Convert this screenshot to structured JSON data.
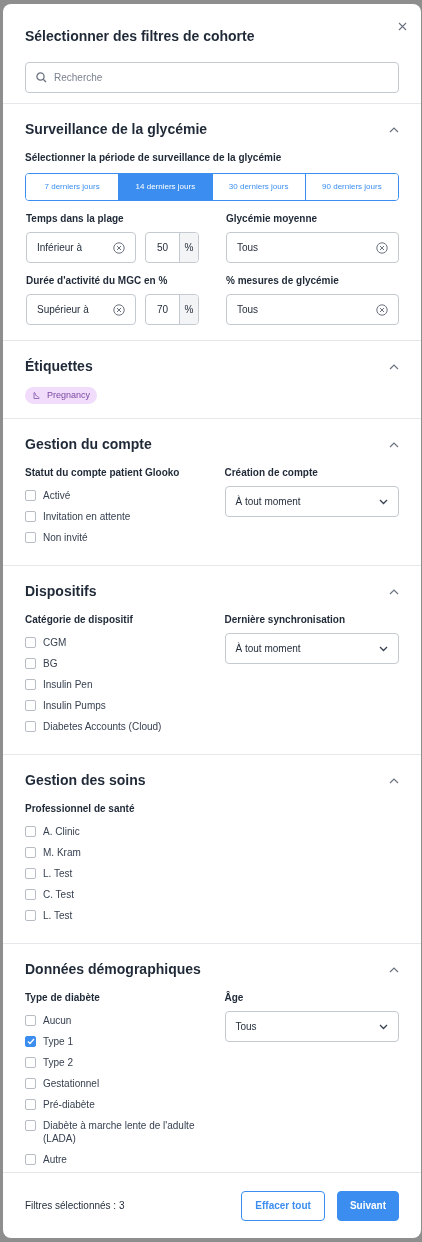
{
  "dialog": {
    "title": "Sélectionner des filtres de cohorte",
    "search": {
      "placeholder": "Recherche"
    }
  },
  "glucose": {
    "title": "Surveillance de la glycémie",
    "expanded": true,
    "period_label": "Sélectionner la période de surveillance de la glycémie",
    "periods": [
      {
        "label": "7 derniers jours",
        "selected": false
      },
      {
        "label": "14 derniers jours",
        "selected": true
      },
      {
        "label": "30 derniers jours",
        "selected": false
      },
      {
        "label": "90 derniers jours",
        "selected": false
      }
    ],
    "filters": [
      {
        "label": "Temps dans la plage",
        "kind": "range",
        "condition": "Inférieur à",
        "value": "50",
        "unit": "%"
      },
      {
        "label": "Glycémie moyenne",
        "kind": "select",
        "value": "Tous"
      },
      {
        "label": "Durée d'activité du MGC en %",
        "kind": "range",
        "condition": "Supérieur à",
        "value": "70",
        "unit": "%"
      },
      {
        "label": "% mesures de glycémie",
        "kind": "select",
        "value": "Tous"
      }
    ]
  },
  "tags": {
    "title": "Étiquettes",
    "expanded": true,
    "items": [
      {
        "label": "Pregnancy"
      }
    ]
  },
  "sections": [
    {
      "title": "Gestion du compte",
      "expanded": true,
      "group": {
        "label": "Statut du compte patient Glooko",
        "options": [
          {
            "label": "Activé",
            "checked": false
          },
          {
            "label": "Invitation en attente",
            "checked": false
          },
          {
            "label": "Non invité",
            "checked": false
          }
        ]
      },
      "dropdown": {
        "label": "Création de compte",
        "value": "À tout moment"
      }
    },
    {
      "title": "Dispositifs",
      "expanded": true,
      "group": {
        "label": "Catégorie de dispositif",
        "options": [
          {
            "label": "CGM",
            "checked": false
          },
          {
            "label": "BG",
            "checked": false
          },
          {
            "label": "Insulin Pen",
            "checked": false
          },
          {
            "label": "Insulin Pumps",
            "checked": false
          },
          {
            "label": "Diabetes Accounts (Cloud)",
            "checked": false
          }
        ]
      },
      "dropdown": {
        "label": "Dernière synchronisation",
        "value": "À tout moment"
      }
    },
    {
      "title": "Gestion des soins",
      "expanded": true,
      "group": {
        "label": "Professionnel de santé",
        "options": [
          {
            "label": "A. Clinic",
            "checked": false
          },
          {
            "label": "M. Kram",
            "checked": false
          },
          {
            "label": "L. Test",
            "checked": false
          },
          {
            "label": "C. Test",
            "checked": false
          },
          {
            "label": "L. Test",
            "checked": false
          }
        ]
      }
    },
    {
      "title": "Données démographiques",
      "expanded": true,
      "group": {
        "label": "Type de diabète",
        "options": [
          {
            "label": "Aucun",
            "checked": false
          },
          {
            "label": "Type 1",
            "checked": true
          },
          {
            "label": "Type 2",
            "checked": false
          },
          {
            "label": "Gestationnel",
            "checked": false
          },
          {
            "label": "Pré-diabète",
            "checked": false
          },
          {
            "label": "Diabète à marche lente de l'adulte (LADA)",
            "checked": false
          },
          {
            "label": "Autre",
            "checked": false
          }
        ]
      },
      "dropdown": {
        "label": "Âge",
        "value": "Tous"
      }
    }
  ],
  "footer": {
    "summary": "Filtres sélectionnés : 3",
    "buttons": [
      {
        "label": "Effacer tout",
        "kind": "secondary"
      },
      {
        "label": "Suivant",
        "kind": "primary"
      }
    ]
  }
}
